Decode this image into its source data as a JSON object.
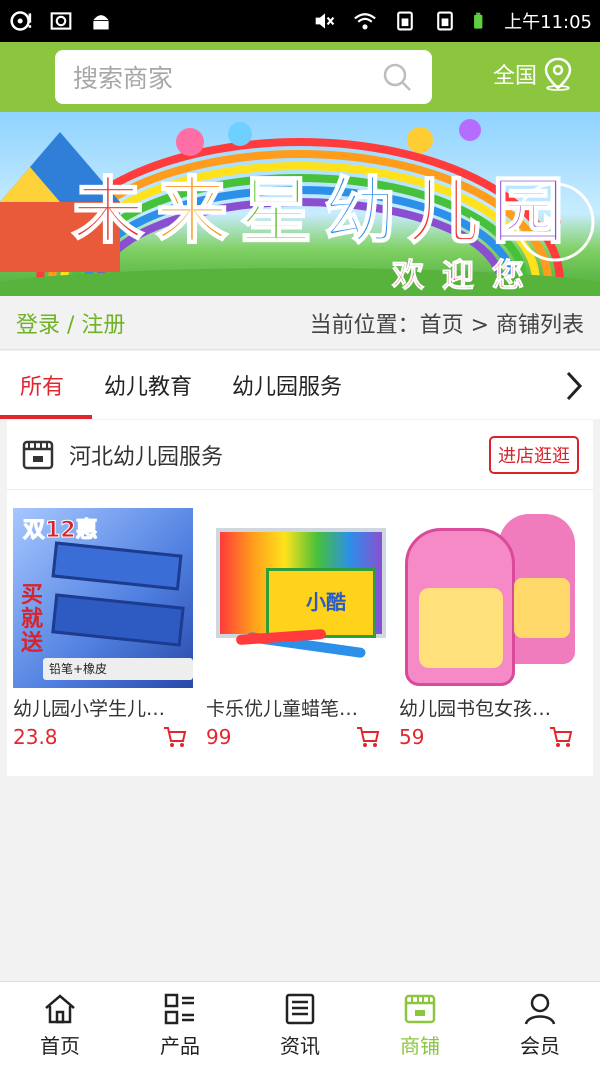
{
  "status_bar": {
    "time": "上午11:05"
  },
  "header": {
    "search_placeholder": "搜索商家",
    "region_label": "全国"
  },
  "banner": {
    "title_chars": [
      "未",
      "来",
      "星",
      "幼",
      "儿",
      "园"
    ],
    "welcome": "欢迎您"
  },
  "location_bar": {
    "login_label": "登录 / 注册",
    "breadcrumb": "当前位置：首页 > 商铺列表"
  },
  "tabs": [
    {
      "label": "所有",
      "active": true
    },
    {
      "label": "幼儿教育",
      "active": false
    },
    {
      "label": "幼儿园服务",
      "active": false
    }
  ],
  "store": {
    "name": "河北幼儿园服务",
    "enter_label": "进店逛逛",
    "products": [
      {
        "title": "幼儿园小学生儿…",
        "price": "23.8",
        "image_text": [
          "双12惠",
          "买",
          "就",
          "送",
          "铅笔+橡皮"
        ]
      },
      {
        "title": "卡乐优儿童蜡笔…",
        "price": "99",
        "image_text": [
          "小酷"
        ]
      },
      {
        "title": "幼儿园书包女孩…",
        "price": "59",
        "image_text": []
      }
    ]
  },
  "bottom_nav": [
    {
      "label": "首页",
      "icon": "home-icon",
      "active": false
    },
    {
      "label": "产品",
      "icon": "grid-list-icon",
      "active": false
    },
    {
      "label": "资讯",
      "icon": "news-icon",
      "active": false
    },
    {
      "label": "商铺",
      "icon": "shop-icon",
      "active": true
    },
    {
      "label": "会员",
      "icon": "user-icon",
      "active": false
    }
  ],
  "colors": {
    "brand_green": "#8cc63f",
    "accent_red": "#e2262e"
  }
}
